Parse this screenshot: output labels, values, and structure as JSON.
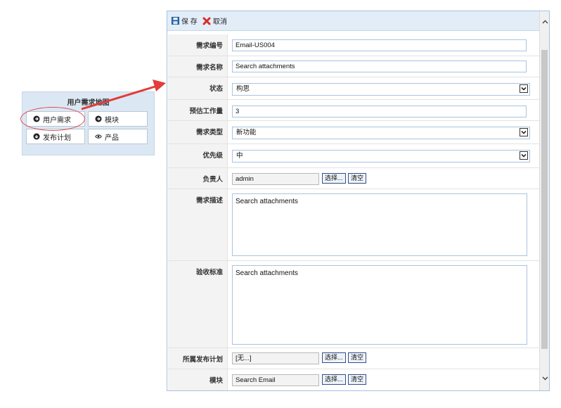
{
  "map_panel": {
    "title": "用户需求地图",
    "buttons": [
      "用户需求",
      "模块",
      "发布计划",
      "产品"
    ]
  },
  "toolbar": {
    "save_label": "保 存",
    "cancel_label": "取消"
  },
  "fields": {
    "req_id": {
      "label": "需求编号",
      "value": "Email-US004"
    },
    "req_name": {
      "label": "需求名称",
      "value": "Search attachments"
    },
    "status": {
      "label": "状态",
      "value": "构思"
    },
    "estimate": {
      "label": "预估工作量",
      "value": "3"
    },
    "req_type": {
      "label": "需求类型",
      "value": "新功能"
    },
    "priority": {
      "label": "优先级",
      "value": "中"
    },
    "owner": {
      "label": "负责人",
      "value": "admin"
    },
    "description": {
      "label": "需求描述",
      "value": "Search attachments"
    },
    "acceptance": {
      "label": "验收标准",
      "value": "Search attachments"
    },
    "release_plan": {
      "label": "所属发布计划",
      "value": "[无...]"
    },
    "module": {
      "label": "模块",
      "value": "Search Email"
    }
  },
  "buttons": {
    "select": "选择...",
    "clear": "清空"
  },
  "colors": {
    "accent_arrow": "#e43b3b",
    "toolbar_bg": "#e3edf8",
    "input_border": "#a9c4de"
  }
}
